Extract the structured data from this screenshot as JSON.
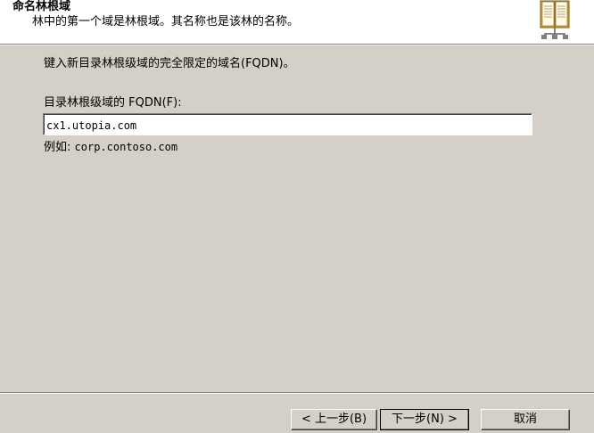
{
  "header": {
    "title": "命名林根域",
    "subtitle": "林中的第一个域是林根域。其名称也是该林的名称。",
    "icon": "directory-book-icon"
  },
  "main": {
    "instruction": "键入新目录林根级域的完全限定的域名(FQDN)。",
    "field_label": "目录林根级域的 FQDN(F):",
    "fqdn_value": "cx1.utopia.com",
    "example_prefix": "例如: ",
    "example_value": "corp.contoso.com"
  },
  "footer": {
    "back_label": "< 上一步(B)",
    "next_label": "下一步(N) >",
    "cancel_label": "取消"
  },
  "colors": {
    "dialog_bg": "#d4d0c8",
    "header_bg": "#ffffff"
  }
}
